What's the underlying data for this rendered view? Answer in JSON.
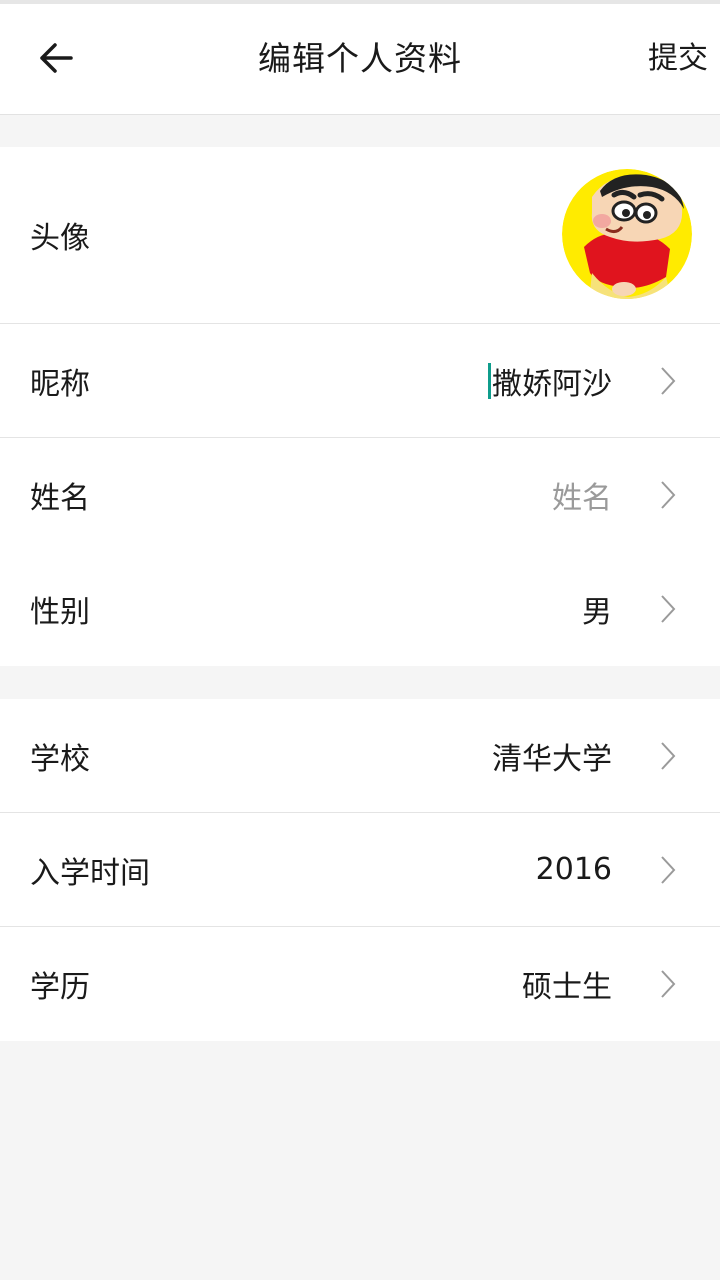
{
  "header": {
    "title": "编辑个人资料",
    "submit_label": "提交"
  },
  "profile": {
    "avatar": {
      "label": "头像"
    },
    "nickname": {
      "label": "昵称",
      "value": "撒娇阿沙"
    },
    "name": {
      "label": "姓名",
      "placeholder": "姓名"
    },
    "gender": {
      "label": "性别",
      "value": "男"
    }
  },
  "education": {
    "school": {
      "label": "学校",
      "value": "清华大学"
    },
    "enrollment_year": {
      "label": "入学时间",
      "value": "2016"
    },
    "degree": {
      "label": "学历",
      "value": "硕士生"
    }
  },
  "colors": {
    "background": "#f5f5f5",
    "surface": "#ffffff",
    "divider": "#e4e4e4",
    "text": "#1a1a1a",
    "placeholder": "#9a9a9a",
    "cursor": "#0f9d8c"
  },
  "icons": {
    "back": "arrow-left-icon",
    "chevron": "chevron-right-icon"
  }
}
